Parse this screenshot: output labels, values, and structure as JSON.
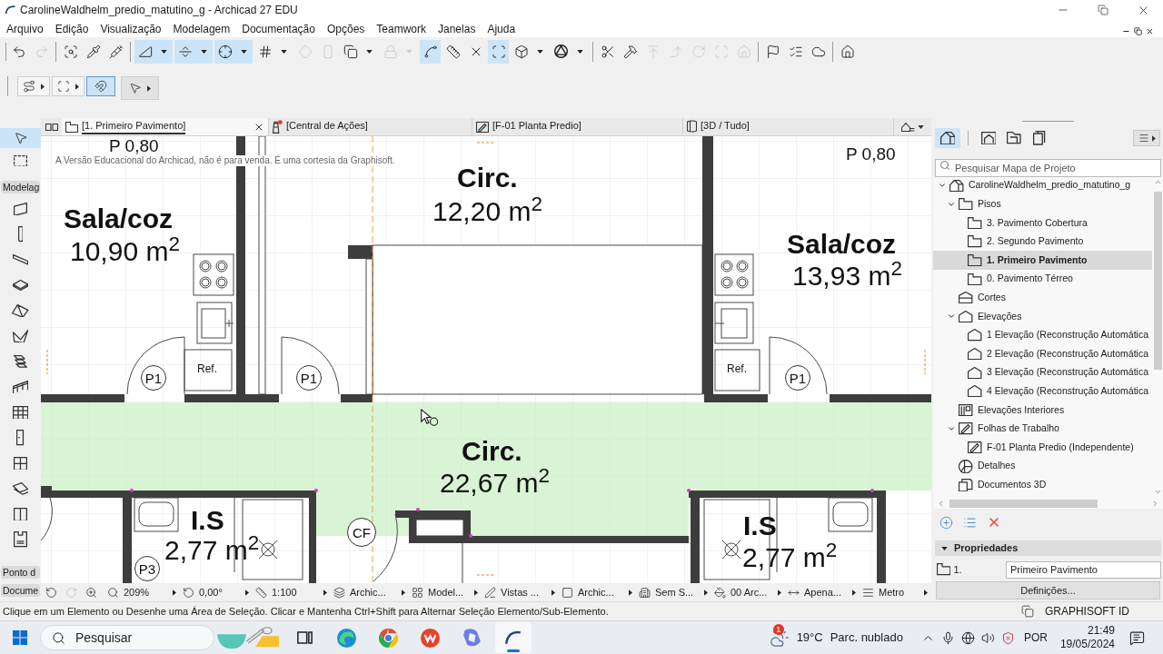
{
  "window": {
    "title": "CarolineWaldhelm_predio_matutino_g - Archicad 27 EDU"
  },
  "menu": [
    "Arquivo",
    "Edição",
    "Visualização",
    "Modelagem",
    "Documentação",
    "Opções",
    "Teamwork",
    "Janelas",
    "Ajuda"
  ],
  "toolbar": {
    "groups": [
      [
        {
          "kind": "plain",
          "selected": false,
          "disabled": false
        },
        {
          "kind": "plain",
          "selected": false,
          "disabled": true
        }
      ],
      [
        {
          "kind": "plain",
          "selected": false,
          "disabled": false
        },
        {
          "kind": "plain",
          "selected": false,
          "disabled": false
        },
        {
          "kind": "plain",
          "selected": false,
          "disabled": false
        }
      ],
      [
        {
          "kind": "split",
          "selected": true,
          "disabled": false
        },
        {
          "kind": "split",
          "selected": true,
          "disabled": false
        },
        {
          "kind": "split",
          "selected": true,
          "disabled": false
        },
        {
          "kind": "split",
          "selected": false,
          "disabled": false
        },
        {
          "kind": "plain",
          "selected": false,
          "disabled": true
        },
        {
          "kind": "plain",
          "selected": false,
          "disabled": true
        },
        {
          "kind": "split",
          "selected": false,
          "disabled": false
        },
        {
          "kind": "split",
          "selected": false,
          "disabled": true
        },
        {
          "kind": "plain",
          "selected": true,
          "disabled": false
        },
        {
          "kind": "plain",
          "selected": false,
          "disabled": false
        },
        {
          "kind": "plain",
          "selected": false,
          "disabled": false
        },
        {
          "kind": "plain",
          "selected": true,
          "disabled": false
        },
        {
          "kind": "split",
          "selected": false,
          "disabled": false
        },
        {
          "kind": "split",
          "selected": false,
          "disabled": false
        }
      ],
      [
        {
          "kind": "plain",
          "selected": false,
          "disabled": false
        },
        {
          "kind": "plain",
          "selected": false,
          "disabled": false
        },
        {
          "kind": "plain",
          "selected": false,
          "disabled": true
        },
        {
          "kind": "plain",
          "selected": false,
          "disabled": true
        },
        {
          "kind": "plain",
          "selected": false,
          "disabled": true
        },
        {
          "kind": "plain",
          "selected": false,
          "disabled": true
        },
        {
          "kind": "plain",
          "selected": false,
          "disabled": true
        }
      ],
      [
        {
          "kind": "plain",
          "selected": false,
          "disabled": false
        },
        {
          "kind": "plain",
          "selected": false,
          "disabled": false
        },
        {
          "kind": "plain",
          "selected": false,
          "disabled": false
        }
      ],
      [
        {
          "kind": "plain",
          "selected": false,
          "disabled": false
        }
      ]
    ]
  },
  "toolbar_2": {
    "items": [
      {
        "kind": "menu",
        "selected": false
      },
      {
        "kind": "menu",
        "selected": false
      },
      {
        "kind": "plain",
        "selected": true
      },
      {
        "kind": "panel",
        "selected": false
      }
    ]
  },
  "toolbox": {
    "tools": [
      {
        "selected": true
      },
      {
        "selected": false
      }
    ],
    "sections": [
      {
        "label": "Modelag",
        "tools": [
          {
            "selected": false
          },
          {
            "selected": false
          },
          {
            "selected": false
          },
          {
            "selected": false
          },
          {
            "selected": false
          },
          {
            "selected": false
          },
          {
            "selected": false
          },
          {
            "selected": false
          },
          {
            "selected": false
          },
          {
            "selected": false
          },
          {
            "selected": false
          },
          {
            "selected": false
          },
          {
            "selected": false
          },
          {
            "selected": false
          }
        ]
      },
      {
        "label": "Ponto d"
      },
      {
        "label": "Docume"
      }
    ]
  },
  "tabs": [
    {
      "kind": "floor-plan",
      "label": "[1. Primeiro Pavimento]",
      "selected": true
    },
    {
      "kind": "action-center",
      "label": "[Central de Ações]",
      "selected": false
    },
    {
      "kind": "worksheet",
      "label": "[F-01 Planta Predio]",
      "selected": false
    },
    {
      "kind": "model",
      "label": "[3D / Tudo]",
      "selected": false
    }
  ],
  "plan": {
    "notice": "A Versão Educacional do Archicad, não é para venda. É uma cortesia da Graphisoft.",
    "level_marks": [
      "P 0,80",
      "P 0,80"
    ],
    "rooms": [
      {
        "name": "Sala/coz",
        "area": "10,90 m$^{2}$"
      },
      {
        "name": "Circ.",
        "area": "12,20 m$^{2}$"
      },
      {
        "name": "Sala/coz",
        "area": "13,93 m$^{2}$"
      },
      {
        "name": "Circ.",
        "area": "22,67 m$^{2}$"
      },
      {
        "name": "I.S",
        "area": "2,77 m$^{2}$"
      },
      {
        "name": "I.S",
        "area": "2,77 m$^{2}$"
      }
    ],
    "fixture_labels": [
      "Ref.",
      "Ref."
    ],
    "markers": [
      "P1",
      "P1",
      "P1",
      "P3",
      "CF"
    ]
  },
  "status_bar": {
    "nav": [
      {
        "disabled": false
      },
      {
        "disabled": true
      },
      {
        "disabled": false
      }
    ],
    "items": [
      {
        "kind": "zoom",
        "label": "209%"
      },
      {
        "kind": "rotation",
        "label": "0,00°"
      },
      {
        "kind": "scale",
        "label": "1:100"
      },
      {
        "kind": "layers",
        "label": "Archic..."
      },
      {
        "kind": "model-view",
        "label": "Model..."
      },
      {
        "kind": "pen-set",
        "label": "Vistas ..."
      },
      {
        "kind": "structure",
        "label": "Archic..."
      },
      {
        "kind": "renovation",
        "label": "Sem S..."
      },
      {
        "kind": "override",
        "label": "00 Arc..."
      },
      {
        "kind": "dimension",
        "label": "Apena..."
      },
      {
        "kind": "unit",
        "label": "Metro"
      }
    ]
  },
  "navigator": {
    "modes": [
      {
        "selected": true
      },
      {
        "selected": false
      },
      {
        "selected": false
      },
      {
        "selected": false
      }
    ],
    "search": {
      "placeholder": "Pesquisar Mapa de Projeto"
    },
    "tree": [
      {
        "kind": "project",
        "label": "CarolineWaldhelm_predio_matutino_g",
        "expanded": true,
        "selected": false,
        "children": [
          {
            "kind": "stories",
            "label": "Pisos",
            "expanded": true,
            "selected": false,
            "children": [
              {
                "kind": "story",
                "label": "3. Pavimento Cobertura",
                "selected": false
              },
              {
                "kind": "story",
                "label": "2. Segundo Pavimento",
                "selected": false
              },
              {
                "kind": "story",
                "label": "1. Primeiro Pavimento",
                "selected": true
              },
              {
                "kind": "story",
                "label": "0. Pavimento Térreo",
                "selected": false
              }
            ]
          },
          {
            "kind": "sections",
            "label": "Cortes",
            "selected": false
          },
          {
            "kind": "elevations",
            "label": "Elevações",
            "expanded": true,
            "selected": false,
            "children": [
              {
                "kind": "elevation",
                "label": "1 Elevação (Reconstrução Automática",
                "selected": false
              },
              {
                "kind": "elevation",
                "label": "2 Elevação (Reconstrução Automática",
                "selected": false
              },
              {
                "kind": "elevation",
                "label": "3 Elevação (Reconstrução Automática",
                "selected": false
              },
              {
                "kind": "elevation",
                "label": "4 Elevação (Reconstrução Automática",
                "selected": false
              }
            ]
          },
          {
            "kind": "interior-elevations",
            "label": "Elevações Interiores",
            "selected": false
          },
          {
            "kind": "worksheets",
            "label": "Folhas de Trabalho",
            "expanded": true,
            "selected": false,
            "children": [
              {
                "kind": "worksheet",
                "label": "F-01 Planta Predio (Independente)",
                "selected": false
              }
            ]
          },
          {
            "kind": "details",
            "label": "Detalhes",
            "selected": false
          },
          {
            "kind": "documents-3d",
            "label": "Documentos 3D",
            "selected": false
          }
        ]
      }
    ],
    "properties": {
      "title": "Propriedades",
      "expanded": true,
      "id": "1.",
      "name": "Primeiro Pavimento",
      "button": "Definições..."
    }
  },
  "message": "Clique em um Elemento ou Desenhe uma Área de Seleção. Clicar e Mantenha Ctrl+Shift para Alternar Seleção Elemento/Sub-Elemento.",
  "account": "GRAPHISOFT ID",
  "taskbar": {
    "search": {
      "placeholder": "Pesquisar"
    },
    "apps": [
      {
        "kind": "task-view",
        "selected": false
      },
      {
        "kind": "edge",
        "selected": false
      },
      {
        "kind": "chrome",
        "selected": false
      },
      {
        "kind": "wps",
        "selected": false
      },
      {
        "kind": "copilot",
        "selected": false
      },
      {
        "kind": "archicad",
        "selected": true
      }
    ],
    "weather": {
      "badge": "1",
      "temperature": "19°C",
      "condition": "Parc. nublado"
    },
    "language": "POR",
    "time": "21:49",
    "date": "19/05/2024"
  }
}
